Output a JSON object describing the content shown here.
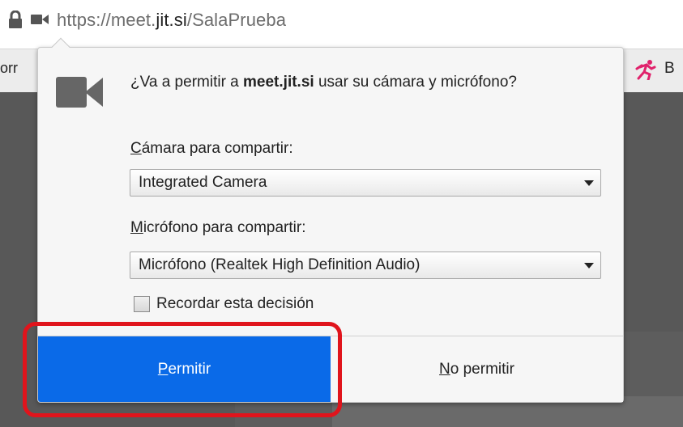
{
  "urlbar": {
    "url_prefix": "https://meet.",
    "url_domain": "jit.si",
    "url_path": "/SalaPrueba",
    "lock_icon": "lock-icon",
    "camera_icon": "camera-icon"
  },
  "background": {
    "left_text": "orr",
    "right_letter": "B",
    "runner_icon": "runner-icon"
  },
  "panel": {
    "question_prefix": "¿Va a permitir a ",
    "question_site": "meet.jit.si",
    "question_suffix": " usar su cámara y micrófono?",
    "camera_label_access": "C",
    "camera_label_rest": "ámara para compartir:",
    "camera_selected": "Integrated Camera",
    "mic_label_access": "M",
    "mic_label_rest": "icrófono para compartir:",
    "mic_selected": "Micrófono (Realtek High Definition Audio)",
    "remember_label": "Recordar esta decisión",
    "remember_checked": false,
    "allow_access": "P",
    "allow_rest": "ermitir",
    "deny_access": "N",
    "deny_rest": "o permitir"
  },
  "colors": {
    "allow_button": "#0a6ae8",
    "highlight": "#e0141c"
  }
}
